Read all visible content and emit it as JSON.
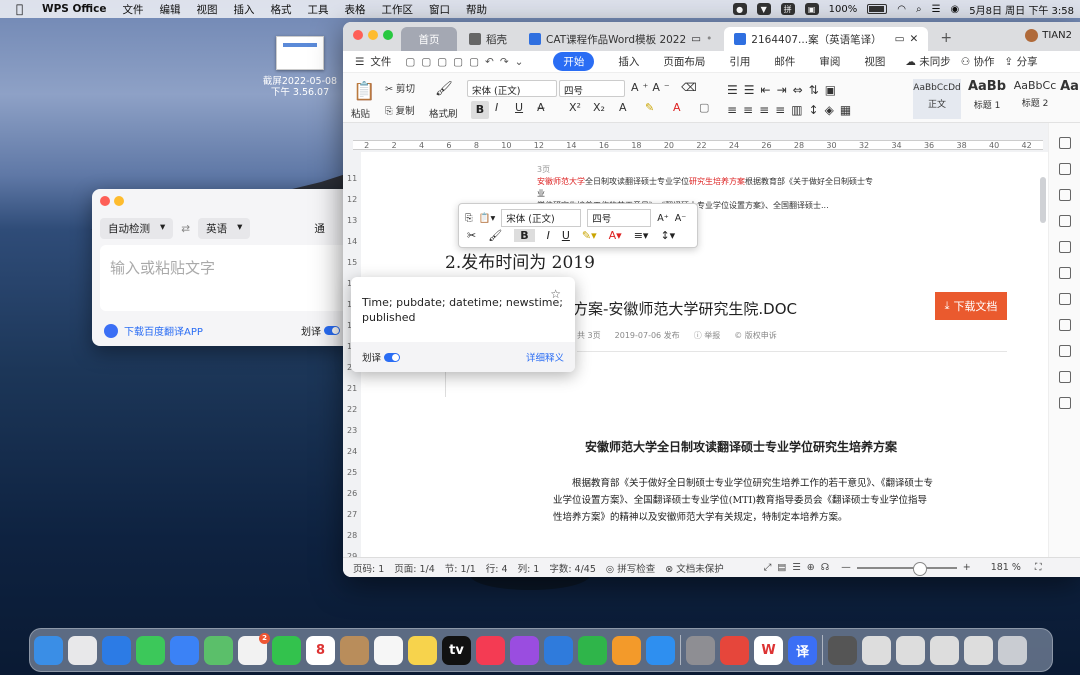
{
  "menubar": {
    "apple": "",
    "app": "WPS Office",
    "items": [
      "文件",
      "编辑",
      "视图",
      "插入",
      "格式",
      "工具",
      "表格",
      "工作区",
      "窗口",
      "帮助"
    ],
    "battery": "100%",
    "datetime": "5月8日 周日 下午 3:58"
  },
  "desktop_file": {
    "name": "截屏2022-05-08",
    "time": "下午 3.56.07"
  },
  "translator": {
    "source_lang": "自动检测",
    "target_lang": "英语",
    "swap": "⇄",
    "input_placeholder": "输入或粘贴文字",
    "download": "下载百度翻译APP",
    "toggle_label": "划译",
    "cut_text": "通"
  },
  "wps": {
    "tabs": [
      {
        "label": "首页"
      },
      {
        "label": "稻壳"
      },
      {
        "label": "CAT课程作品Word模板 2022"
      },
      {
        "label": "2164407...案（英语笔译）"
      }
    ],
    "plus": "+",
    "user": "TIAN2",
    "menu": {
      "file": "文件",
      "items": [
        "开始",
        "插入",
        "页面布局",
        "引用",
        "邮件",
        "审阅",
        "视图"
      ],
      "right": [
        "未同步",
        "协作",
        "分享"
      ]
    },
    "ribbon": {
      "paste": "粘贴",
      "cut": "剪切",
      "copy": "复制",
      "format_painter": "格式刷",
      "font": "宋体 (正文)",
      "size": "四号",
      "styles": [
        {
          "preview": "AaBbCcDd",
          "name": "正文"
        },
        {
          "preview": "AaBb",
          "name": "标题 1"
        },
        {
          "preview": "AaBbCc",
          "name": "标题 2"
        },
        {
          "preview": "Aa",
          "name": ""
        }
      ]
    },
    "ruler": [
      "2",
      "2",
      "4",
      "6",
      "8",
      "10",
      "12",
      "14",
      "16",
      "18",
      "20",
      "22",
      "24",
      "26",
      "28",
      "30",
      "32",
      "34",
      "36",
      "38",
      "40",
      "42"
    ],
    "vruler": [
      "11",
      "12",
      "13",
      "14",
      "15",
      "16",
      "17",
      "18",
      "19",
      "20",
      "21",
      "22",
      "23",
      "24",
      "25",
      "26",
      "27",
      "28",
      "29"
    ],
    "doc": {
      "pagenum": "3页",
      "snippet_red1": "安徽师范大学",
      "snippet_a": "全日制攻读翻译硕士专业学位",
      "snippet_red2": "研究生培养方案",
      "snippet_b": "根据教育部《关于做好全日制硕士专业",
      "snippet_c": "学位研究生培养工作的若干意见》、《翻译硕士专业学位设置方案》、全国翻译硕士...",
      "heading": "2.发布时间为 2019",
      "doc_title": "方案-安徽师范大学研究生院.DOC",
      "download_btn": "下载文档",
      "meta": [
        "共 3页",
        "2019-07-06 发布",
        "举报",
        "版权申诉"
      ],
      "main_title": "安徽师范大学全日制攻读翻译硕士专业学位研究生培养方案",
      "para": "根据教育部《关于做好全日制硕士专业学位研究生培养工作的若干意见》、《翻译硕士专业学位设置方案》、全国翻译硕士专业学位(MTI)教育指导委员会《翻译硕士专业学位指导性培养方案》的精神以及安徽师范大学有关规定，特制定本培养方案。"
    },
    "status": {
      "page": "页码: 1",
      "pages": "页面: 1/4",
      "section": "节: 1/1",
      "row": "行: 4",
      "col": "列: 1",
      "words": "字数: 4/45",
      "spell": "拼写检查",
      "protect": "文档未保护",
      "zoom": "181 %",
      "zoom_level": 0.56
    }
  },
  "minitoolbar": {
    "font": "宋体 (正文)",
    "size": "四号"
  },
  "popup": {
    "definition": "Time; pubdate; datetime; newstime; published",
    "toggle_label": "划译",
    "detail": "详细释义"
  },
  "dock": [
    {
      "name": "Finder",
      "color": "#3a8ee6"
    },
    {
      "name": "Launchpad",
      "color": "#e8e8ea"
    },
    {
      "name": "Safari",
      "color": "#2c7be5"
    },
    {
      "name": "Messages",
      "color": "#3cc85a"
    },
    {
      "name": "Mail",
      "color": "#3b82f6"
    },
    {
      "name": "Maps",
      "color": "#5bbf6a"
    },
    {
      "name": "Photos",
      "color": "#f2f2f2",
      "badge": "2"
    },
    {
      "name": "FaceTime",
      "color": "#33c24d"
    },
    {
      "name": "Calendar",
      "color": "#ffffff",
      "text": "8"
    },
    {
      "name": "Contacts",
      "color": "#b98d5b"
    },
    {
      "name": "Reminders",
      "color": "#f6f6f6"
    },
    {
      "name": "Notes",
      "color": "#f7d34c"
    },
    {
      "name": "TV",
      "color": "#111111",
      "text": "tv"
    },
    {
      "name": "Music",
      "color": "#f43b53"
    },
    {
      "name": "Podcasts",
      "color": "#9a4de0"
    },
    {
      "name": "Keynote",
      "color": "#2f7bdc"
    },
    {
      "name": "Numbers",
      "color": "#2fb54a"
    },
    {
      "name": "Pages",
      "color": "#f39a2a"
    },
    {
      "name": "App Store",
      "color": "#2e8ff0"
    },
    {
      "name": "System Preferences",
      "color": "#8e8e93"
    },
    {
      "name": "Chrome",
      "color": "#e6463b"
    },
    {
      "name": "WPS",
      "color": "#ffffff",
      "text": "W"
    },
    {
      "name": "Baidu Translate",
      "color": "#3b6ff5",
      "text": "译"
    },
    {
      "name": "Preview",
      "color": "#555"
    },
    {
      "name": "Window1",
      "color": "#ddd"
    },
    {
      "name": "Window2",
      "color": "#ddd"
    },
    {
      "name": "Window3",
      "color": "#ddd"
    },
    {
      "name": "Window4",
      "color": "#ddd"
    },
    {
      "name": "Trash",
      "color": "#c9ccd2"
    }
  ]
}
